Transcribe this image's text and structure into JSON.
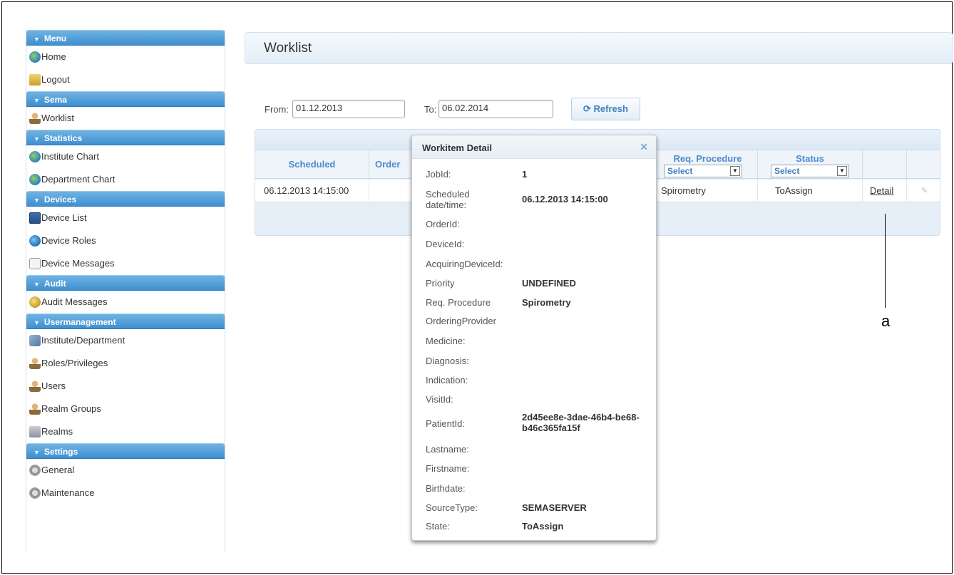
{
  "sidebar": {
    "sections": [
      {
        "title": "Menu",
        "items": [
          {
            "label": "Home",
            "icon": "home-icon"
          },
          {
            "label": "Logout",
            "icon": "logout-icon"
          }
        ]
      },
      {
        "title": "Sema",
        "items": [
          {
            "label": "Worklist",
            "icon": "worklist-icon"
          }
        ]
      },
      {
        "title": "Statistics",
        "items": [
          {
            "label": "Institute Chart",
            "icon": "globe-icon"
          },
          {
            "label": "Department Chart",
            "icon": "globe-icon"
          }
        ]
      },
      {
        "title": "Devices",
        "items": [
          {
            "label": "Device List",
            "icon": "device-list-icon"
          },
          {
            "label": "Device Roles",
            "icon": "device-roles-icon"
          },
          {
            "label": "Device Messages",
            "icon": "messages-icon"
          }
        ]
      },
      {
        "title": "Audit",
        "items": [
          {
            "label": "Audit Messages",
            "icon": "audit-icon"
          }
        ]
      },
      {
        "title": "Usermanagement",
        "items": [
          {
            "label": "Institute/Department",
            "icon": "institute-icon"
          },
          {
            "label": "Roles/Privileges",
            "icon": "user-icon"
          },
          {
            "label": "Users",
            "icon": "user-icon"
          },
          {
            "label": "Realm Groups",
            "icon": "user-icon"
          },
          {
            "label": "Realms",
            "icon": "realms-icon"
          }
        ]
      },
      {
        "title": "Settings",
        "items": [
          {
            "label": "General",
            "icon": "gear-icon"
          },
          {
            "label": "Maintenance",
            "icon": "gear-icon"
          }
        ]
      }
    ]
  },
  "page": {
    "title": "Worklist"
  },
  "filters": {
    "from_label": "From:",
    "from_value": "01.12.2013",
    "to_label": "To:",
    "to_value": "06.02.2014",
    "refresh_label": "Refresh"
  },
  "grid": {
    "columns": {
      "scheduled": "Scheduled",
      "order": "Order",
      "req_procedure": "Req. Procedure",
      "status": "Status"
    },
    "filter_select": "Select",
    "row": {
      "scheduled": "06.12.2013 14:15:00",
      "req_procedure": "Spirometry",
      "status": "ToAssign",
      "detail": "Detail"
    }
  },
  "dialog": {
    "title": "Workitem Detail",
    "fields": [
      {
        "label": "JobId:",
        "value": "1"
      },
      {
        "label": "Scheduled date/time:",
        "value": "06.12.2013 14:15:00"
      },
      {
        "label": "OrderId:",
        "value": ""
      },
      {
        "label": "DeviceId:",
        "value": ""
      },
      {
        "label": "AcquiringDeviceId:",
        "value": ""
      },
      {
        "label": "Priority",
        "value": "UNDEFINED"
      },
      {
        "label": "Req. Procedure",
        "value": "Spirometry"
      },
      {
        "label": "OrderingProvider",
        "value": ""
      },
      {
        "label": "Medicine:",
        "value": ""
      },
      {
        "label": "Diagnosis:",
        "value": ""
      },
      {
        "label": "Indication:",
        "value": ""
      },
      {
        "label": "VisitId:",
        "value": ""
      },
      {
        "label": "PatientId:",
        "value": "2d45ee8e-3dae-46b4-be68-b46c365fa15f"
      },
      {
        "label": "Lastname:",
        "value": ""
      },
      {
        "label": "Firstname:",
        "value": ""
      },
      {
        "label": "Birthdate:",
        "value": ""
      },
      {
        "label": "SourceType:",
        "value": "SEMASERVER"
      },
      {
        "label": "State:",
        "value": "ToAssign"
      }
    ]
  },
  "annotation": {
    "label": "a"
  }
}
